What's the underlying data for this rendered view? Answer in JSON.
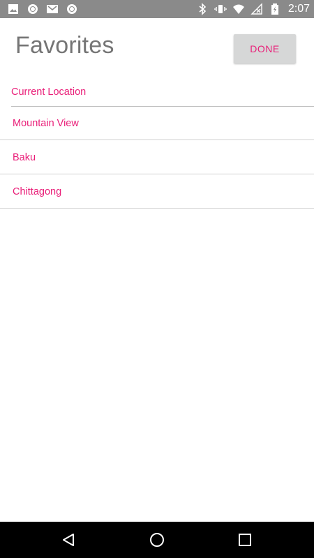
{
  "status_bar": {
    "time": "2:07",
    "left_icons": [
      "image-icon",
      "record-icon",
      "mail-icon",
      "record-icon"
    ],
    "right_icons": [
      "bluetooth-icon",
      "vibrate-icon",
      "wifi-icon",
      "no-signal-icon",
      "battery-icon"
    ]
  },
  "header": {
    "title": "Favorites",
    "done_label": "DONE"
  },
  "list": {
    "current_location": "Current Location",
    "items": [
      {
        "label": "Mountain View"
      },
      {
        "label": "Baku"
      },
      {
        "label": "Chittagong"
      }
    ]
  },
  "nav_bar": {
    "buttons": [
      "back-icon",
      "home-icon",
      "recents-icon"
    ]
  },
  "colors": {
    "accent": "#e91e78",
    "title": "#757575",
    "status_bar": "#8a8a8a",
    "button_bg": "#d6d7d7",
    "divider": "#d0d0d0"
  }
}
